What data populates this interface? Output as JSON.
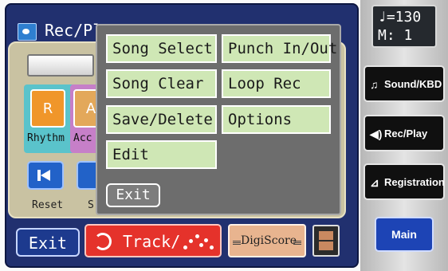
{
  "header": {
    "title": "Rec/Pl"
  },
  "parts": {
    "rhythm": {
      "button": "R",
      "label": "Rhythm"
    },
    "accomp": {
      "button": "A",
      "label": "Acc"
    }
  },
  "transport": {
    "reset_label": "Reset",
    "s_label": "S"
  },
  "popup": {
    "items": [
      "Song Select",
      "Punch In/Out",
      "Song Clear",
      "Loop Rec",
      "Save/Delete",
      "Options",
      "Edit"
    ],
    "exit": "Exit"
  },
  "bottom": {
    "exit": "Exit",
    "track": "Track/",
    "digiscore": "DigiScore"
  },
  "side": {
    "tempo": "♩=130",
    "measure": "M:   1",
    "sound_kbd": "Sound/KBD",
    "rec_play": "Rec/Play",
    "registration": "Registration",
    "main": "Main"
  },
  "icons": [
    "music-note-icon",
    "loop-icon",
    "dots-icon",
    "book-icon",
    "speaker-icon",
    "registration-icon",
    "reset-icon"
  ],
  "colors": {
    "screen": "#21306f",
    "menu_item": "#cfe7b5",
    "track_button": "#e5322b",
    "digiscore_button": "#e8b48f",
    "main_button": "#1d44b5"
  }
}
